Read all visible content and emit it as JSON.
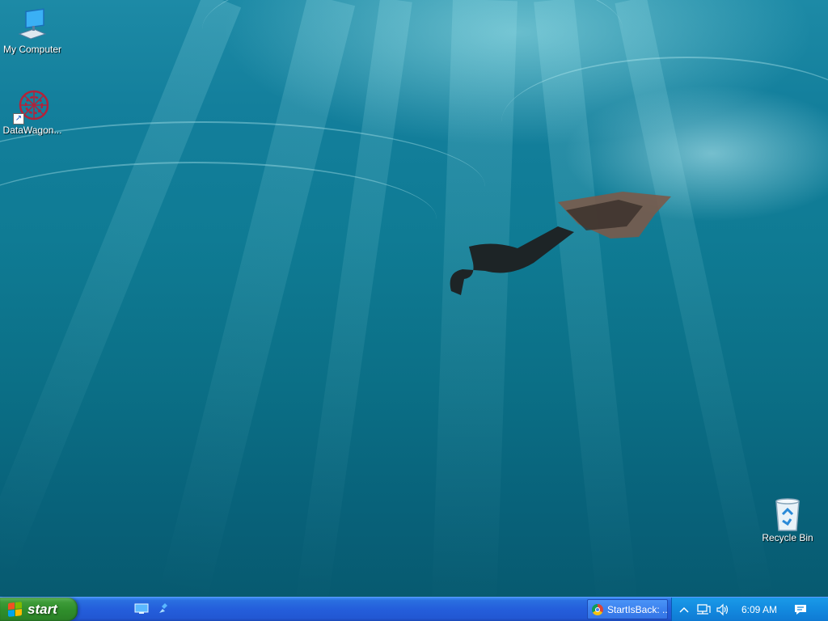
{
  "desktop": {
    "icons": [
      {
        "label": "My Computer",
        "icon": "computer-icon"
      },
      {
        "label": "DataWagon...",
        "icon": "datawagon-icon"
      },
      {
        "label": "Recycle Bin",
        "icon": "recycle-bin-icon"
      }
    ]
  },
  "taskbar": {
    "start_label": "start",
    "quick_launch": [
      "show-desktop-icon",
      "pin-icon"
    ],
    "tasks": [
      {
        "label": "StartIsBack: ...",
        "icon": "chrome-icon"
      }
    ],
    "tray": {
      "icons": [
        "chevron-up-icon",
        "network-icon",
        "volume-icon"
      ],
      "clock": "6:09 AM",
      "notification_icon": "action-center-icon"
    }
  },
  "colors": {
    "taskbar_blue": "#245edb",
    "start_green": "#3d9b38",
    "tray_blue": "#138adf",
    "wallpaper_teal": "#0f7b94"
  }
}
